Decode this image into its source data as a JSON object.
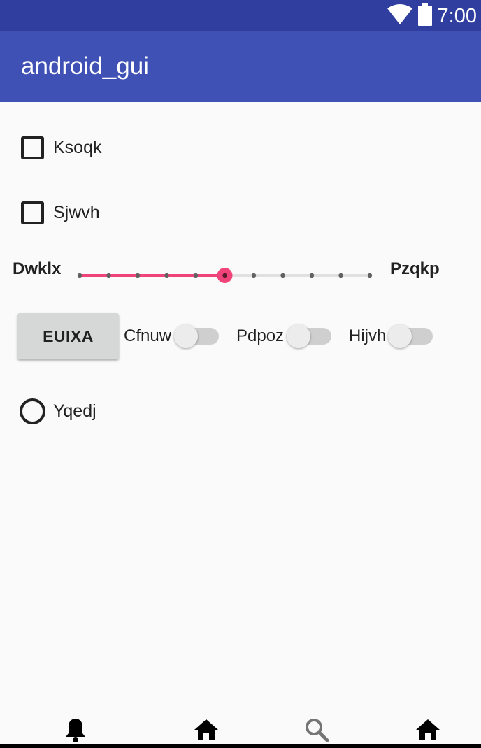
{
  "status_bar": {
    "time": "7:00",
    "icons": [
      "wifi-icon",
      "battery-icon"
    ]
  },
  "app_bar": {
    "title": "android_gui",
    "color": "#3f51b5",
    "status_color": "#303f9f"
  },
  "checkboxes": [
    {
      "label": "Ksoqk",
      "checked": false
    },
    {
      "label": "Sjwvh",
      "checked": false
    }
  ],
  "slider": {
    "min_label": "Dwklx",
    "max_label": "Pzqkp",
    "steps": 10,
    "value": 5,
    "accent": "#f0437a"
  },
  "button": {
    "label": "EUIXA"
  },
  "switches": [
    {
      "label": "Cfnuw",
      "on": false
    },
    {
      "label": "Pdpoz",
      "on": false
    },
    {
      "label": "Hijvh",
      "on": false
    }
  ],
  "radio": {
    "label": "Yqedj",
    "selected": false
  },
  "bottom_nav": {
    "items": [
      "bell-icon",
      "home-icon",
      "search-icon",
      "home-icon"
    ]
  }
}
